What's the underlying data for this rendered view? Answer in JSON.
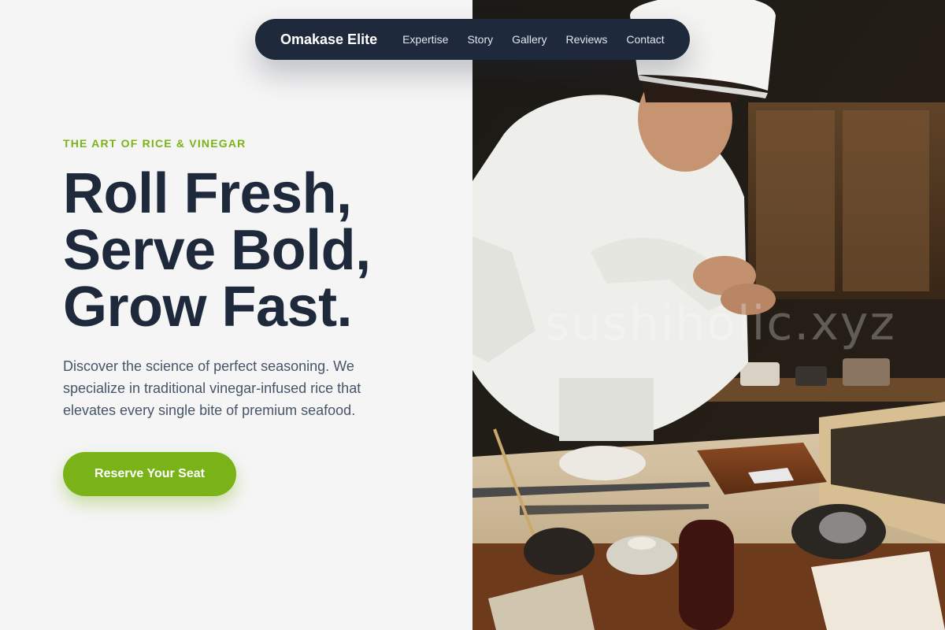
{
  "nav": {
    "brand": "Omakase Elite",
    "links": [
      "Expertise",
      "Story",
      "Gallery",
      "Reviews",
      "Contact"
    ]
  },
  "hero": {
    "eyebrow": "THE ART OF RICE & VINEGAR",
    "headline": [
      "Roll Fresh,",
      "Serve Bold,",
      "Grow Fast."
    ],
    "lead": "Discover the science of perfect seasoning. We specialize in traditional vinegar-infused rice that elevates every single bite of premium seafood.",
    "cta_label": "Reserve Your Seat"
  },
  "photo": {
    "watermark": "sushiholic.xyz"
  },
  "colors": {
    "accent": "#7ab317",
    "navy": "#1e293b",
    "background": "#f5f5f5",
    "body_text": "#475569"
  }
}
